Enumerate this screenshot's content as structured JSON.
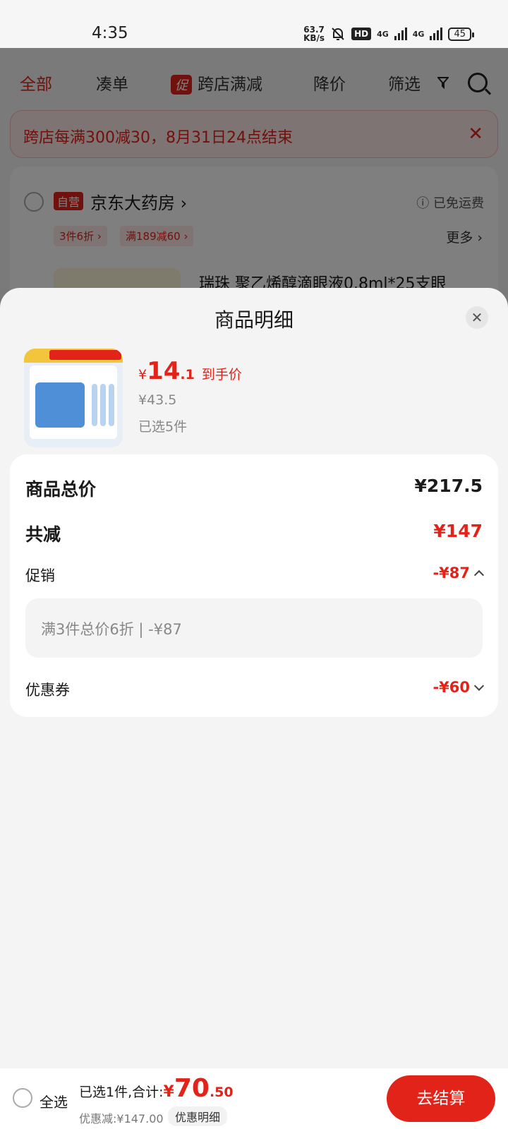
{
  "status_bar": {
    "time": "4:35",
    "net_speed_value": "63.7",
    "net_speed_unit": "KB/s",
    "hd_label": "HD",
    "network_1": "4G",
    "network_2": "4G",
    "battery": "45",
    "icons": [
      "mute-bell-icon",
      "signal-icon",
      "signal-icon",
      "battery-icon"
    ]
  },
  "background_page": {
    "tabs": [
      {
        "label": "全部",
        "active": true
      },
      {
        "label": "凑单",
        "active": false
      },
      {
        "label": "跨店满减",
        "badge": "促",
        "active": false
      },
      {
        "label": "降价",
        "active": false
      },
      {
        "label": "筛选",
        "active": false
      }
    ],
    "banner": {
      "text": "跨店每满300减30，8月31日24点结束",
      "close_icon": "close-icon"
    },
    "store": {
      "badge": "自营",
      "name": "京东大药房 ›",
      "shipping": "ⓘ 已免运费",
      "coupons": [
        "3件6折 ›",
        "满189减60 ›"
      ],
      "more": "更多 ›",
      "product_title": "瑞珠 聚乙烯醇滴眼液0.8ml*25支眼"
    }
  },
  "sheet": {
    "title": "商品明细",
    "close_icon": "close-icon",
    "product": {
      "price_currency": "¥",
      "price_int": "14",
      "price_dec": ".1",
      "price_tag": "到手价",
      "original_price": "¥43.5",
      "selected_qty": "已选5件"
    },
    "details": {
      "total_label": "商品总价",
      "total_value": "¥217.5",
      "discount_label": "共减",
      "discount_value": "¥147",
      "promo_label": "促销",
      "promo_value": "-¥87",
      "promo_detail": "满3件总价6折 | -¥87",
      "coupon_label": "优惠券",
      "coupon_value": "-¥60"
    }
  },
  "bottom_bar": {
    "select_all": "全选",
    "summary_prefix": "已选1件,合计:",
    "total_currency": "¥",
    "total_int": "70",
    "total_dec": ".50",
    "savings": "优惠减:¥147.00",
    "detail_button": "优惠明细",
    "checkout_button": "去结算"
  },
  "colors": {
    "accent": "#e2231a",
    "overlay": "rgba(0,0,0,0.5)",
    "sheet_background": "#f4f4f4"
  }
}
